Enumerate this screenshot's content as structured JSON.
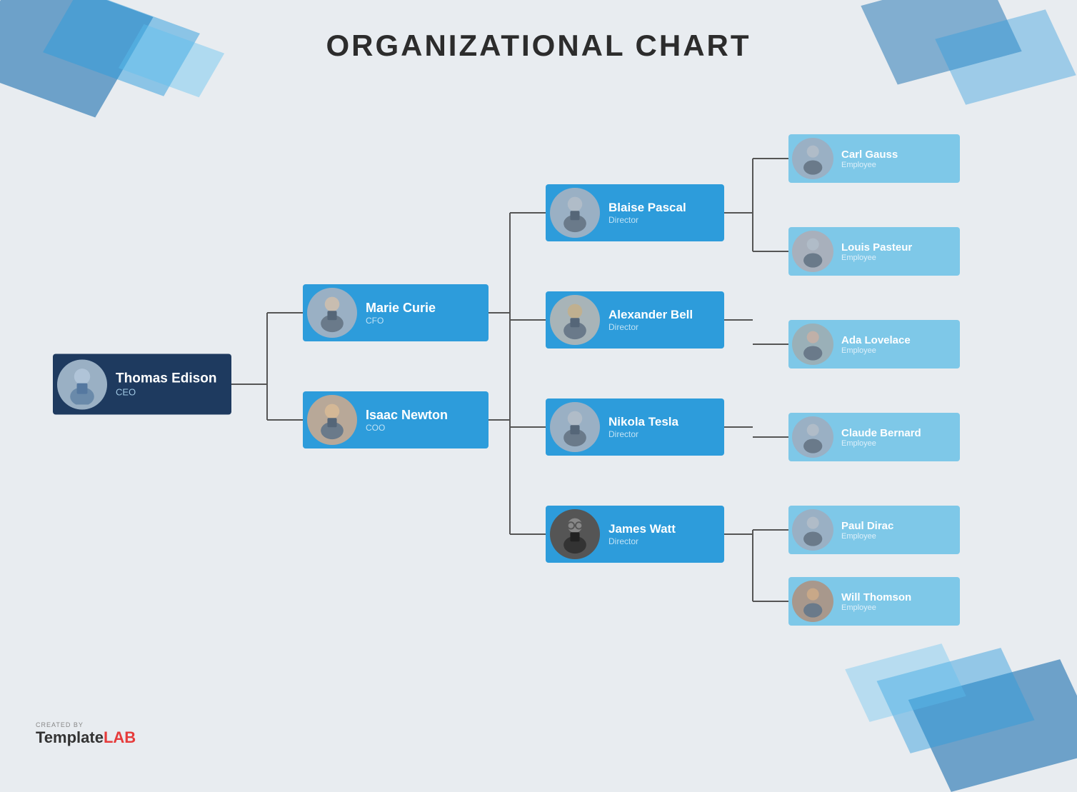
{
  "title": "ORGANIZATIONAL CHART",
  "nodes": {
    "ceo": {
      "name": "Thomas Edison",
      "role": "CEO"
    },
    "marie": {
      "name": "Marie Curie",
      "role": "CFO"
    },
    "isaac": {
      "name": "Isaac Newton",
      "role": "COO"
    },
    "blaise": {
      "name": "Blaise Pascal",
      "role": "Director"
    },
    "alex": {
      "name": "Alexander Bell",
      "role": "Director"
    },
    "nikola": {
      "name": "Nikola Tesla",
      "role": "Director"
    },
    "james": {
      "name": "James Watt",
      "role": "Director"
    },
    "carl": {
      "name": "Carl Gauss",
      "role": "Employee"
    },
    "louis": {
      "name": "Louis Pasteur",
      "role": "Employee"
    },
    "ada": {
      "name": "Ada Lovelace",
      "role": "Employee"
    },
    "claude": {
      "name": "Claude Bernard",
      "role": "Employee"
    },
    "paul": {
      "name": "Paul Dirac",
      "role": "Employee"
    },
    "will": {
      "name": "Will Thomson",
      "role": "Employee"
    }
  },
  "footer": {
    "created_by": "CREATED BY",
    "template": "Template",
    "lab": "LAB"
  }
}
